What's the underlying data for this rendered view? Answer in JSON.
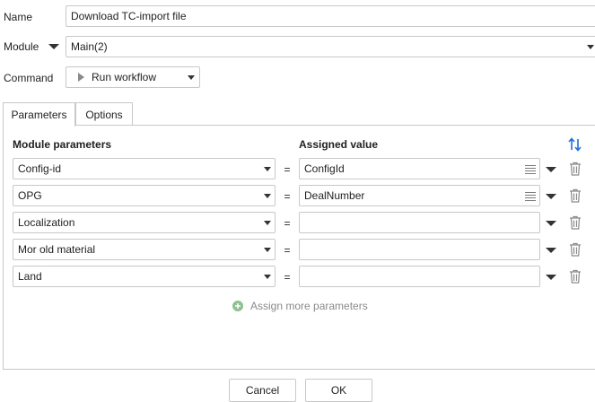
{
  "form": {
    "name_label": "Name",
    "name_value": "Download TC-import file",
    "module_label": "Module",
    "module_value": "Main(2)",
    "command_label": "Command",
    "command_value": "Run workflow"
  },
  "tabs": [
    {
      "label": "Parameters",
      "active": true
    },
    {
      "label": "Options",
      "active": false
    }
  ],
  "params": {
    "col_module": "Module parameters",
    "col_assigned": "Assigned value",
    "eq": "=",
    "rows": [
      {
        "param": "Config-id",
        "value": "ConfigId"
      },
      {
        "param": "OPG",
        "value": "DealNumber"
      },
      {
        "param": "Localization",
        "value": ""
      },
      {
        "param": "Mor old material",
        "value": ""
      },
      {
        "param": "Land",
        "value": ""
      }
    ],
    "assign_more": "Assign more parameters"
  },
  "buttons": {
    "cancel": "Cancel",
    "ok": "OK"
  },
  "colors": {
    "accent_blue": "#1e73d8",
    "add_green": "#8fc18f",
    "border": "#c8c8c8"
  }
}
